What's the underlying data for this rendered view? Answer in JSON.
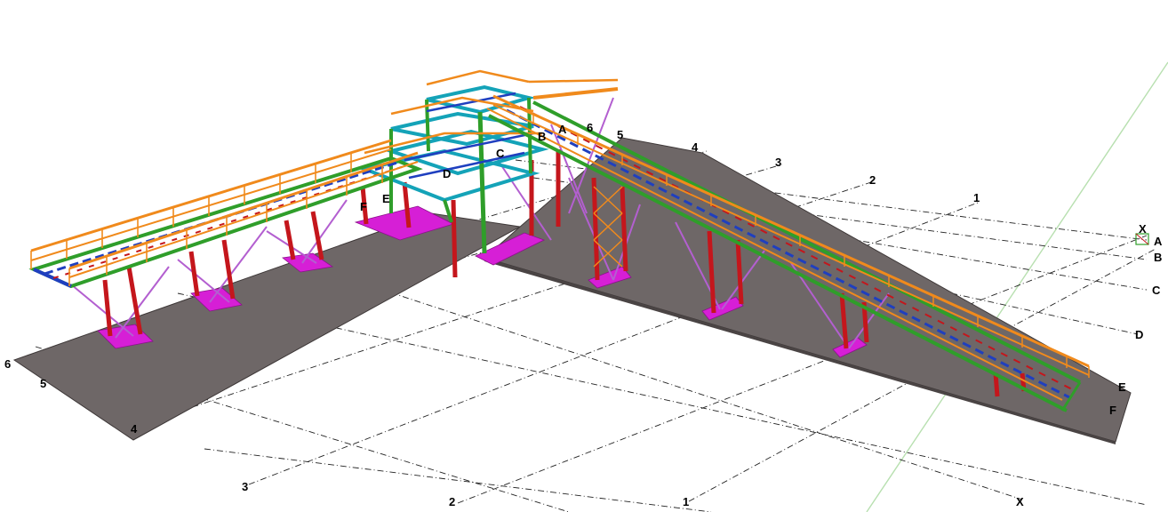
{
  "colors": {
    "background": "#ffffff",
    "slab": "#6e6767",
    "slab_edge": "#3e3838",
    "footing": "#d61fd6",
    "column": "#c4161c",
    "brace": "#b35fd0",
    "beam_green": "#2f9e2a",
    "beam_teal": "#14a3b8",
    "joist_blue": "#1f3fbf",
    "railing": "#f08a1c",
    "gridline": "#222222",
    "axis_line": "#b8e0b0"
  },
  "grid_labels": {
    "number_row_back": [
      "4",
      "3",
      "2",
      "1"
    ],
    "number_row_front": [
      "6",
      "5",
      "4",
      "3",
      "2",
      "1"
    ],
    "letter_column_right": [
      "A",
      "B",
      "C",
      "D",
      "E",
      "F"
    ],
    "letters_on_structure": [
      "A",
      "B",
      "C",
      "D",
      "E",
      "F"
    ],
    "numbers_on_structure": [
      "6",
      "5"
    ],
    "x_marks": [
      "X",
      "X"
    ]
  },
  "scene": {
    "title": "",
    "legs": [
      "walkway-left",
      "ramp-right",
      "tower"
    ]
  }
}
